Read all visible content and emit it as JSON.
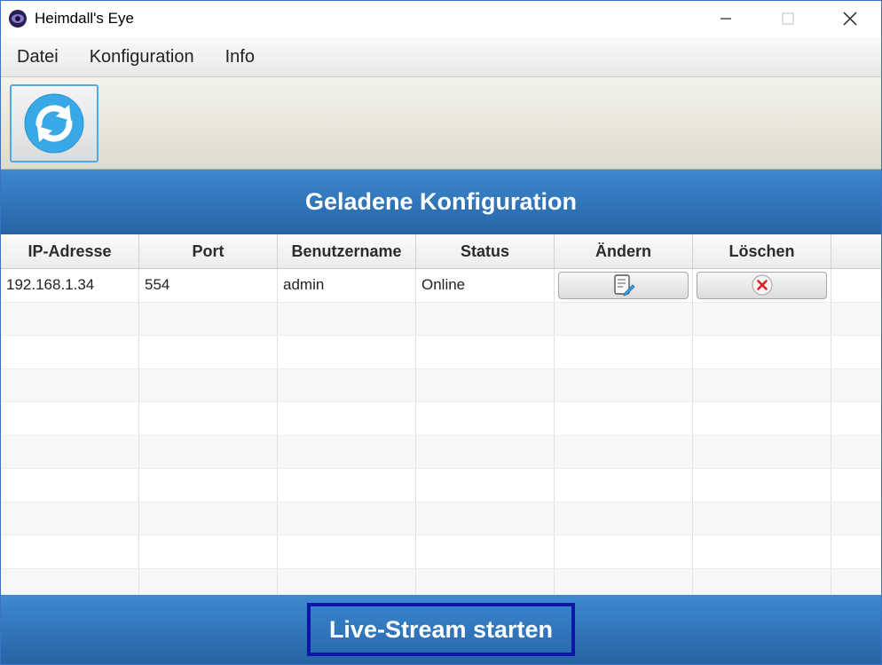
{
  "window": {
    "title": "Heimdall's Eye"
  },
  "menu": {
    "items": [
      "Datei",
      "Konfiguration",
      "Info"
    ]
  },
  "toolbar": {
    "refresh_icon": "refresh-icon"
  },
  "section": {
    "title": "Geladene Konfiguration"
  },
  "table": {
    "headers": [
      "IP-Adresse",
      "Port",
      "Benutzername",
      "Status",
      "Ändern",
      "Löschen"
    ],
    "rows": [
      {
        "ip": "192.168.1.34",
        "port": "554",
        "user": "admin",
        "status": "Online",
        "edit_icon": "edit-icon",
        "delete_icon": "delete-icon"
      }
    ]
  },
  "footer": {
    "live_button": "Live-Stream starten"
  },
  "colors": {
    "header_blue": "#2f73b8",
    "live_button_border": "#0b16a8",
    "refresh_icon": "#38a9e6",
    "delete_x": "#e02020"
  }
}
